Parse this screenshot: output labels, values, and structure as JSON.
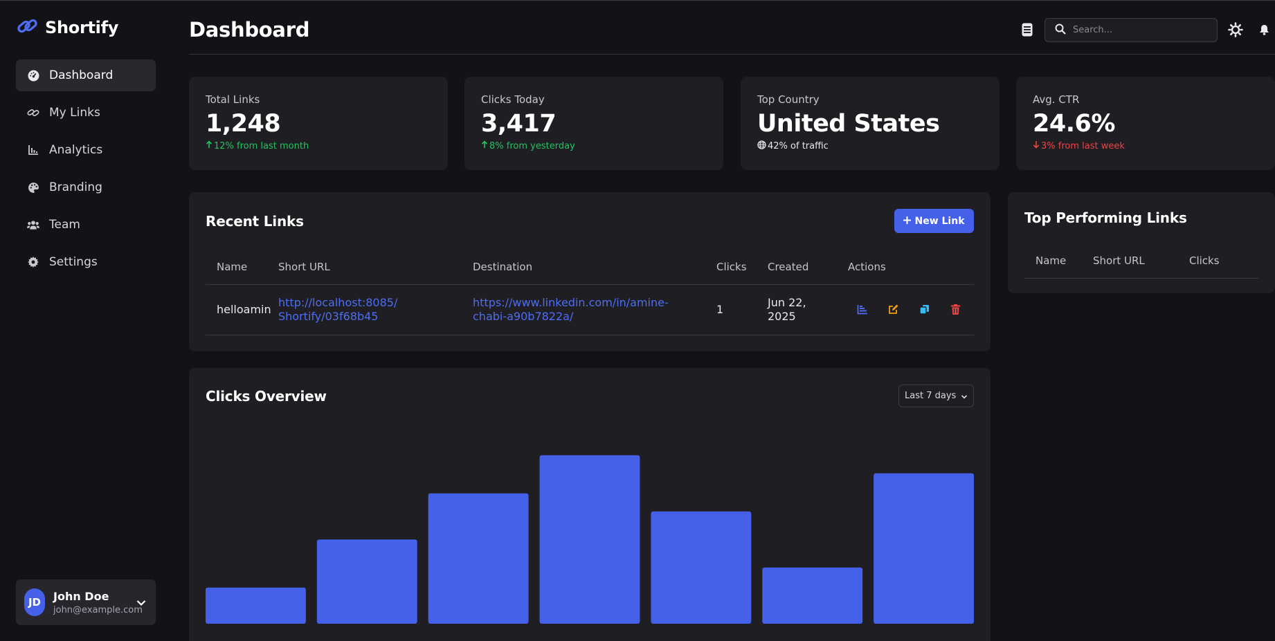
{
  "app": {
    "name": "Shortify",
    "accent": "#4561e9"
  },
  "sidebar": {
    "items": [
      {
        "label": "Dashboard",
        "icon": "gauge-icon",
        "active": true
      },
      {
        "label": "My Links",
        "icon": "link-icon"
      },
      {
        "label": "Analytics",
        "icon": "chart-icon"
      },
      {
        "label": "Branding",
        "icon": "palette-icon"
      },
      {
        "label": "Team",
        "icon": "users-icon"
      },
      {
        "label": "Settings",
        "icon": "gear-icon"
      }
    ]
  },
  "user": {
    "initials": "JD",
    "name": "John Doe",
    "email": "john@example.com"
  },
  "header": {
    "title": "Dashboard",
    "search_placeholder": "Search..."
  },
  "stats": [
    {
      "label": "Total Links",
      "value": "1,248",
      "sub": "12% from last month",
      "trend": "up"
    },
    {
      "label": "Clicks Today",
      "value": "3,417",
      "sub": "8% from yesterday",
      "trend": "up"
    },
    {
      "label": "Top Country",
      "value": "United States",
      "sub": "42% of traffic",
      "trend": "globe"
    },
    {
      "label": "Avg. CTR",
      "value": "24.6%",
      "sub": "3% from last week",
      "trend": "down"
    }
  ],
  "recent_links": {
    "title": "Recent Links",
    "new_button": "New Link",
    "columns": [
      "Name",
      "Short URL",
      "Destination",
      "Clicks",
      "Created",
      "Actions"
    ],
    "rows": [
      {
        "name": "helloamin",
        "short_url_1": "http://localhost:8085/",
        "short_url_2": "Shortify/03f68b45",
        "destination_1": "https://www.linkedin.com/in/amine-",
        "destination_2": "chabi-a90b7822a/",
        "clicks": "1",
        "created_1": "Jun 22,",
        "created_2": "2025"
      }
    ]
  },
  "top_links": {
    "title": "Top Performing Links",
    "columns": [
      "Name",
      "Short URL",
      "Clicks"
    ]
  },
  "clicks_overview": {
    "title": "Clicks Overview",
    "range_selected": "Last 7 days"
  },
  "chart_data": {
    "type": "bar",
    "values": [
      18,
      42,
      65,
      84,
      56,
      28,
      75
    ],
    "ylim": [
      0,
      100
    ],
    "color": "#4561e9"
  }
}
